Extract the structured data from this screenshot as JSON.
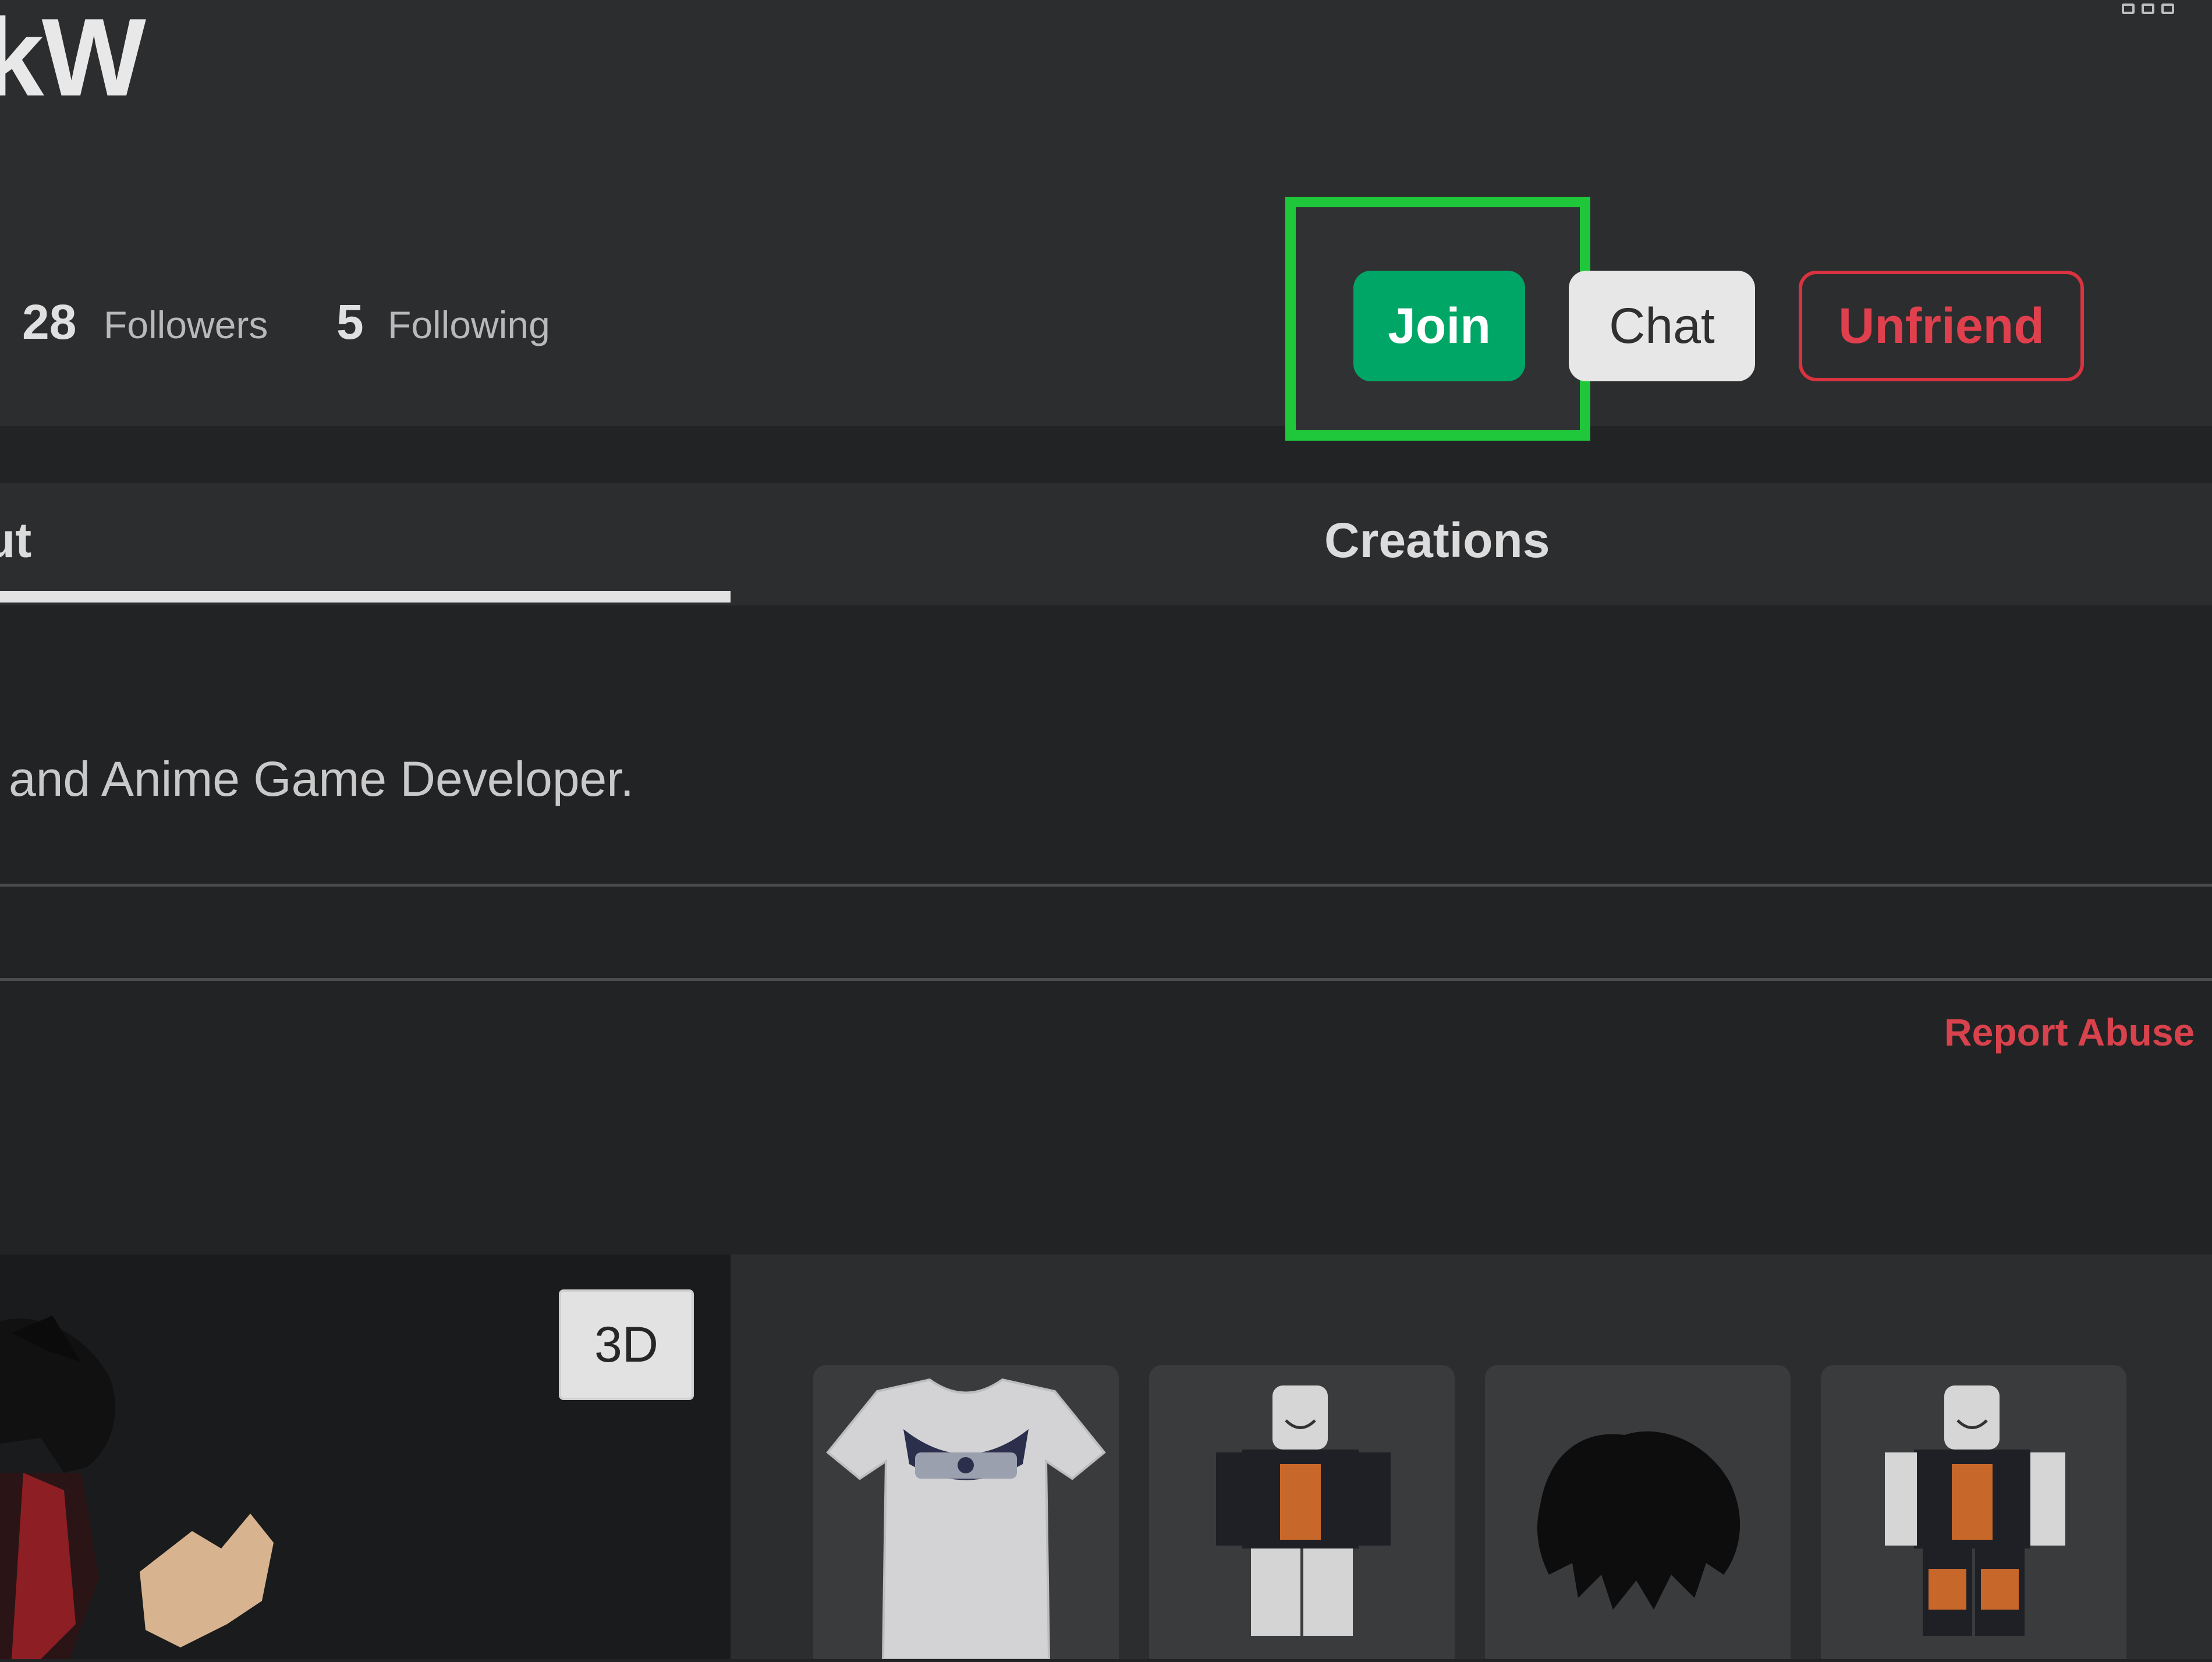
{
  "header": {
    "username": "kW",
    "followers_count": "28",
    "followers_label": "Followers",
    "following_count": "5",
    "following_label": "Following",
    "join_label": "Join",
    "chat_label": "Chat",
    "unfriend_label": "Unfriend"
  },
  "tabs": [
    {
      "label": "ut",
      "active": true
    },
    {
      "label": "Creations",
      "active": false
    }
  ],
  "about": {
    "description": "and Anime Game Developer.",
    "report_label": "Report Abuse"
  },
  "avatar": {
    "view_toggle_label": "3D"
  },
  "currently_wearing": [
    {
      "icon": "shirt-icon"
    },
    {
      "icon": "outfit-icon"
    },
    {
      "icon": "hair-icon"
    },
    {
      "icon": "outfit-icon"
    }
  ],
  "colors": {
    "join": "#00a665",
    "highlight": "#1fc83a",
    "unfriend": "#d9333f",
    "report": "#d8424c"
  }
}
